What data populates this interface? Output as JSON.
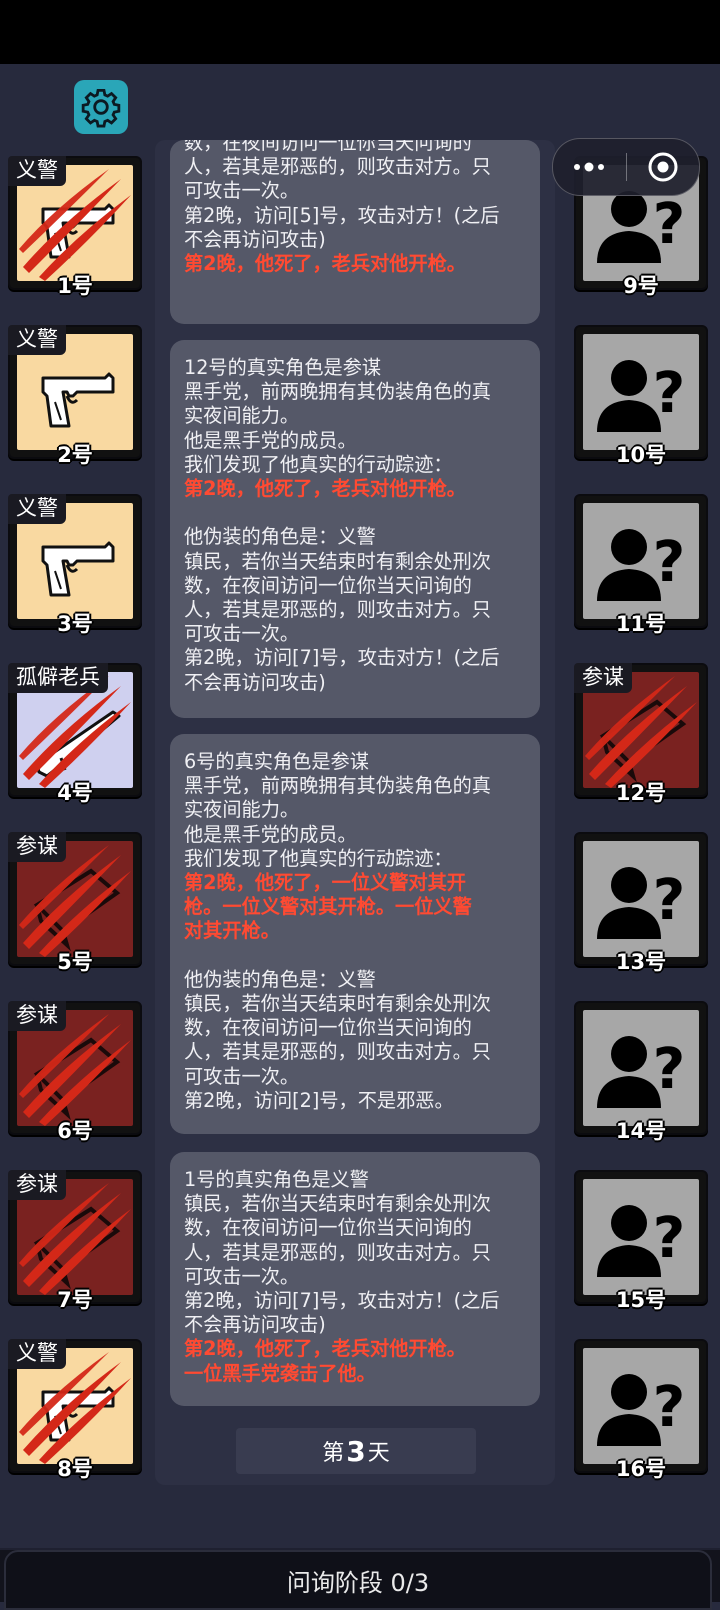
{
  "day_button": {
    "prefix": "第",
    "number": "3",
    "suffix": "天"
  },
  "phase_bar": "问询阶段 0/3",
  "left_players": [
    {
      "number": "1号",
      "tag": "义警",
      "role": "vigilante",
      "dead": true
    },
    {
      "number": "2号",
      "tag": "义警",
      "role": "vigilante",
      "dead": false
    },
    {
      "number": "3号",
      "tag": "义警",
      "role": "vigilante",
      "dead": false
    },
    {
      "number": "4号",
      "tag": "孤僻老兵",
      "role": "veteran",
      "dead": true
    },
    {
      "number": "5号",
      "tag": "参谋",
      "role": "mastermind",
      "dead": true
    },
    {
      "number": "6号",
      "tag": "参谋",
      "role": "mastermind",
      "dead": true
    },
    {
      "number": "7号",
      "tag": "参谋",
      "role": "mastermind",
      "dead": true
    },
    {
      "number": "8号",
      "tag": "义警",
      "role": "vigilante",
      "dead": true
    }
  ],
  "right_players": [
    {
      "number": "9号",
      "tag": "",
      "role": "unknown",
      "dead": false
    },
    {
      "number": "10号",
      "tag": "",
      "role": "unknown",
      "dead": false
    },
    {
      "number": "11号",
      "tag": "",
      "role": "unknown",
      "dead": false
    },
    {
      "number": "12号",
      "tag": "参谋",
      "role": "mastermind",
      "dead": true
    },
    {
      "number": "13号",
      "tag": "",
      "role": "unknown",
      "dead": false
    },
    {
      "number": "14号",
      "tag": "",
      "role": "unknown",
      "dead": false
    },
    {
      "number": "15号",
      "tag": "",
      "role": "unknown",
      "dead": false
    },
    {
      "number": "16号",
      "tag": "",
      "role": "unknown",
      "dead": false
    }
  ],
  "messages": [
    {
      "lines": [
        {
          "text": "数，在夜间访问一位你当天问询的",
          "red": false
        },
        {
          "text": "人，若其是邪恶的，则攻击对方。只",
          "red": false
        },
        {
          "text": "可攻击一次。",
          "red": false
        },
        {
          "text": "第2晚，访问[5]号，攻击对方！(之后",
          "red": false
        },
        {
          "text": "不会再访问攻击)",
          "red": false
        },
        {
          "text": "第2晚，他死了，老兵对他开枪。",
          "red": true
        }
      ]
    },
    {
      "lines": [
        {
          "text": "12号的真实角色是参谋",
          "red": false
        },
        {
          "text": "黑手党，前两晚拥有其伪装角色的真",
          "red": false
        },
        {
          "text": "实夜间能力。",
          "red": false
        },
        {
          "text": "他是黑手党的成员。",
          "red": false
        },
        {
          "text": "我们发现了他真实的行动踪迹：",
          "red": false
        },
        {
          "text": "第2晚，他死了，老兵对他开枪。",
          "red": true
        },
        {
          "text": "",
          "red": false
        },
        {
          "text": "他伪装的角色是：义警",
          "red": false
        },
        {
          "text": "镇民，若你当天结束时有剩余处刑次",
          "red": false
        },
        {
          "text": "数，在夜间访问一位你当天问询的",
          "red": false
        },
        {
          "text": "人，若其是邪恶的，则攻击对方。只",
          "red": false
        },
        {
          "text": "可攻击一次。",
          "red": false
        },
        {
          "text": "第2晚，访问[7]号，攻击对方！(之后",
          "red": false
        },
        {
          "text": "不会再访问攻击)",
          "red": false
        }
      ]
    },
    {
      "lines": [
        {
          "text": "6号的真实角色是参谋",
          "red": false
        },
        {
          "text": "黑手党，前两晚拥有其伪装角色的真",
          "red": false
        },
        {
          "text": "实夜间能力。",
          "red": false
        },
        {
          "text": "他是黑手党的成员。",
          "red": false
        },
        {
          "text": "我们发现了他真实的行动踪迹：",
          "red": false
        },
        {
          "text": "第2晚，他死了，一位义警对其开",
          "red": true
        },
        {
          "text": "枪。一位义警对其开枪。一位义警",
          "red": true
        },
        {
          "text": "对其开枪。",
          "red": true
        },
        {
          "text": "",
          "red": false
        },
        {
          "text": "他伪装的角色是：义警",
          "red": false
        },
        {
          "text": "镇民，若你当天结束时有剩余处刑次",
          "red": false
        },
        {
          "text": "数，在夜间访问一位你当天问询的",
          "red": false
        },
        {
          "text": "人，若其是邪恶的，则攻击对方。只",
          "red": false
        },
        {
          "text": "可攻击一次。",
          "red": false
        },
        {
          "text": "第2晚，访问[2]号，不是邪恶。",
          "red": false
        }
      ]
    },
    {
      "lines": [
        {
          "text": "1号的真实角色是义警",
          "red": false
        },
        {
          "text": "镇民，若你当天结束时有剩余处刑次",
          "red": false
        },
        {
          "text": "数，在夜间访问一位你当天问询的",
          "red": false
        },
        {
          "text": "人，若其是邪恶的，则攻击对方。只",
          "red": false
        },
        {
          "text": "可攻击一次。",
          "red": false
        },
        {
          "text": "第2晚，访问[7]号，攻击对方！(之后",
          "red": false
        },
        {
          "text": "不会再访问攻击)",
          "red": false
        },
        {
          "text": "第2晚，他死了，老兵对他开枪。",
          "red": true
        },
        {
          "text": "一位黑手党袭击了他。",
          "red": true
        }
      ]
    }
  ]
}
